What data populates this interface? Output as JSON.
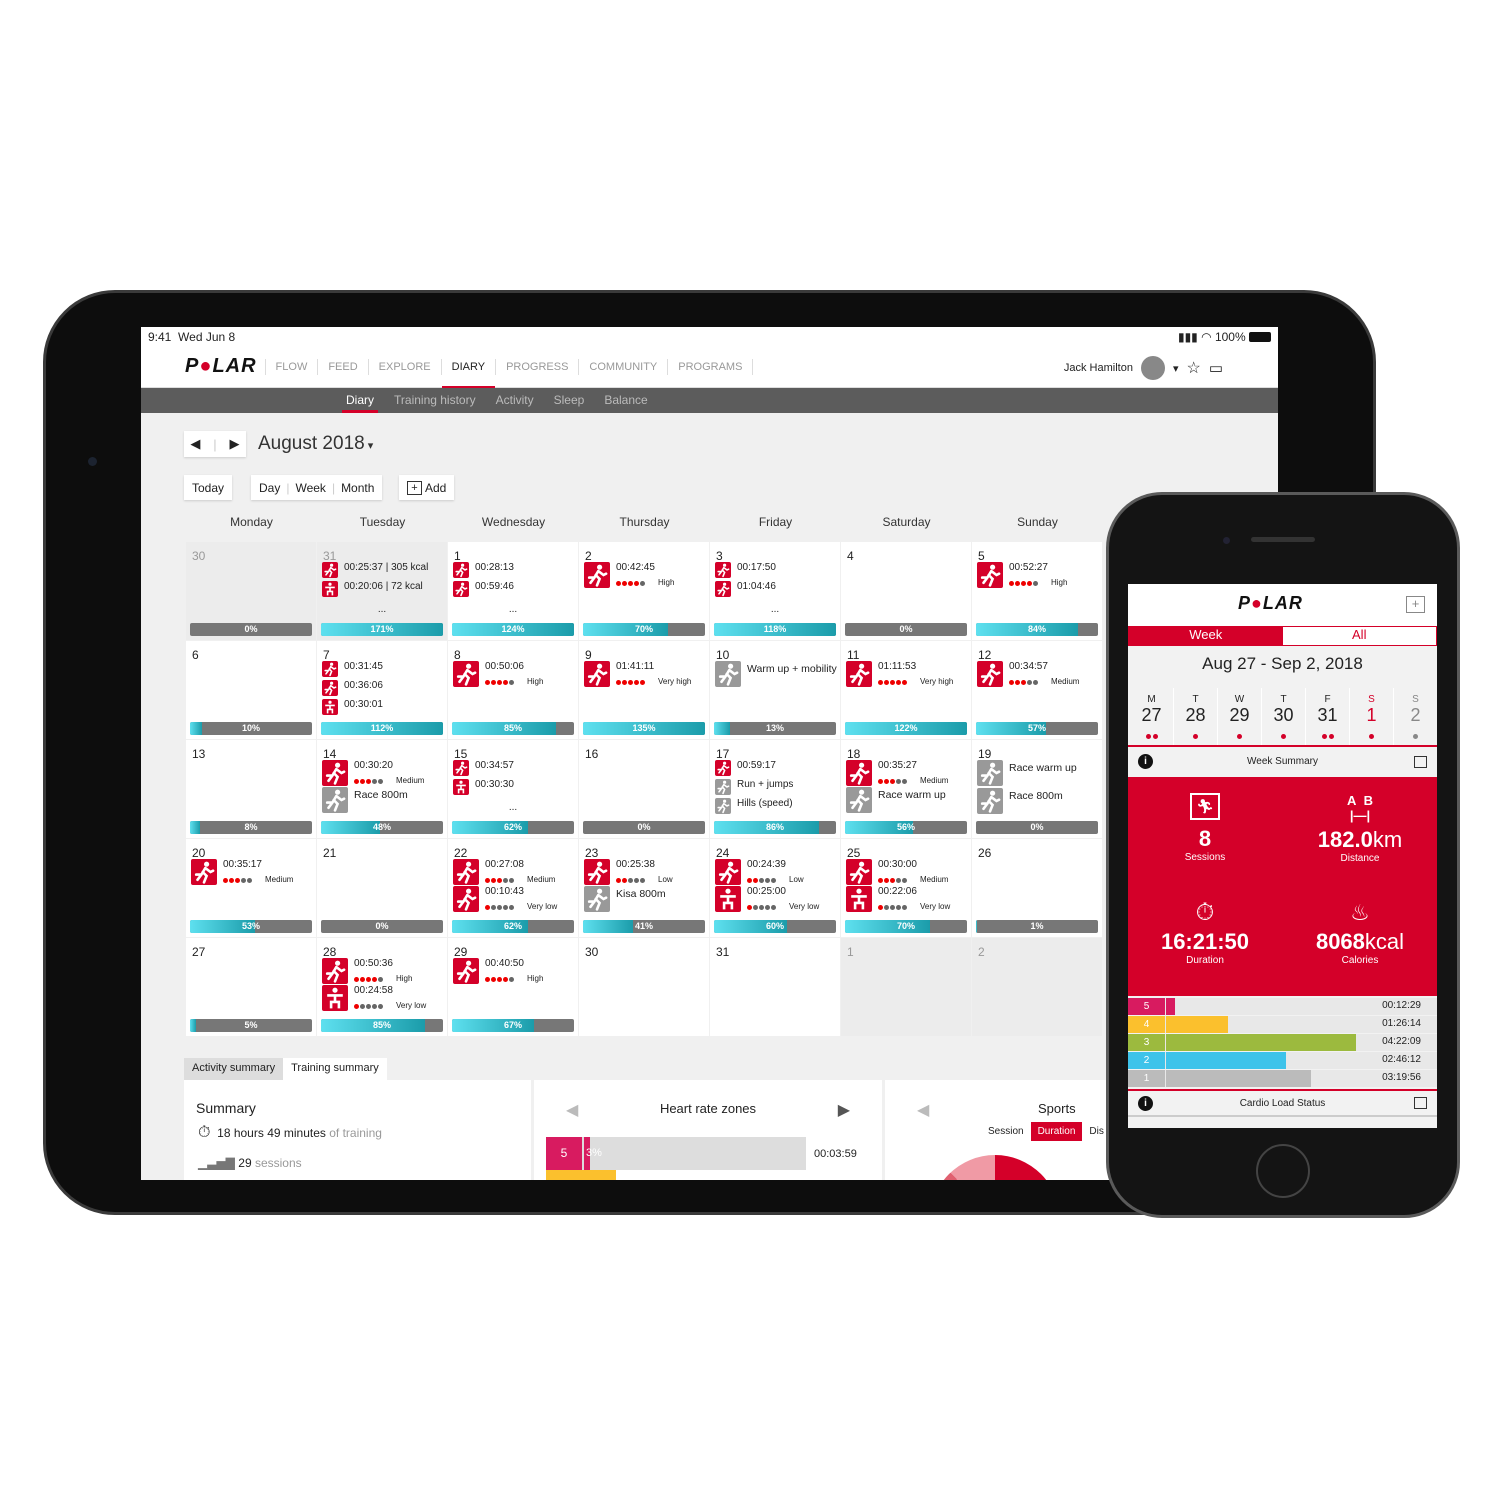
{
  "status": {
    "time": "9:41",
    "date": "Wed Jun 8",
    "battery": "100%"
  },
  "brand": {
    "logo": "POLAR",
    "accent": "#d40029",
    "teal": "#1b9caa"
  },
  "nav": {
    "items": [
      "FLOW",
      "FEED",
      "EXPLORE",
      "DIARY",
      "PROGRESS",
      "COMMUNITY",
      "PROGRAMS"
    ],
    "active": "DIARY",
    "user": "Jack Hamilton"
  },
  "subnav": {
    "items": [
      "Diary",
      "Training history",
      "Activity",
      "Sleep",
      "Balance"
    ],
    "active": "Diary"
  },
  "calendar": {
    "month": "August 2018",
    "today": "Today",
    "day": "Day",
    "week": "Week",
    "month_btn": "Month",
    "add": "Add",
    "weekdays": [
      "Monday",
      "Tuesday",
      "Wednesday",
      "Thursday",
      "Friday",
      "Saturday",
      "Sunday"
    ],
    "cells": [
      {
        "day": "30",
        "muted": true,
        "progress": 0,
        "sessions": []
      },
      {
        "day": "31",
        "muted": true,
        "progress": 171,
        "more": "...",
        "sessions": [
          {
            "sport": "run",
            "time": "00:25:37 | 305 kcal"
          },
          {
            "sport": "strength",
            "time": "00:20:06 | 72 kcal"
          }
        ]
      },
      {
        "day": "1",
        "progress": 124,
        "more": "...",
        "sessions": [
          {
            "sport": "run",
            "time": "00:28:13"
          },
          {
            "sport": "run",
            "time": "00:59:46"
          }
        ]
      },
      {
        "day": "2",
        "progress": 70,
        "sessions": [
          {
            "sport": "run",
            "time": "00:42:45",
            "dots": 4,
            "intensity": "High"
          }
        ]
      },
      {
        "day": "3",
        "progress": 118,
        "more": "...",
        "sessions": [
          {
            "sport": "run",
            "time": "00:17:50"
          },
          {
            "sport": "run",
            "time": "01:04:46"
          }
        ]
      },
      {
        "day": "4",
        "progress": 0,
        "sessions": []
      },
      {
        "day": "5",
        "progress": 84,
        "sessions": [
          {
            "sport": "run",
            "time": "00:52:27",
            "dots": 4,
            "intensity": "High"
          }
        ]
      },
      {
        "day": "6",
        "progress": 10,
        "sessions": []
      },
      {
        "day": "7",
        "progress": 112,
        "sessions": [
          {
            "sport": "run",
            "time": "00:31:45"
          },
          {
            "sport": "run",
            "time": "00:36:06"
          },
          {
            "sport": "strength",
            "time": "00:30:01"
          }
        ]
      },
      {
        "day": "8",
        "progress": 85,
        "sessions": [
          {
            "sport": "run",
            "time": "00:50:06",
            "dots": 4,
            "intensity": "High"
          }
        ]
      },
      {
        "day": "9",
        "progress": 135,
        "sessions": [
          {
            "sport": "run",
            "time": "01:41:11",
            "dots": 5,
            "intensity": "Very high"
          }
        ]
      },
      {
        "day": "10",
        "progress": 13,
        "sessions": [
          {
            "sport": "run",
            "planned": true,
            "time": "Warm up + mobility"
          }
        ]
      },
      {
        "day": "11",
        "progress": 122,
        "sessions": [
          {
            "sport": "run",
            "time": "01:11:53",
            "dots": 5,
            "intensity": "Very high"
          }
        ]
      },
      {
        "day": "12",
        "progress": 57,
        "sessions": [
          {
            "sport": "run",
            "time": "00:34:57",
            "dots": 3,
            "intensity": "Medium"
          }
        ]
      },
      {
        "day": "13",
        "progress": 8,
        "sessions": []
      },
      {
        "day": "14",
        "progress": 48,
        "sessions": [
          {
            "sport": "run",
            "time": "00:30:20",
            "dots": 3,
            "intensity": "Medium"
          },
          {
            "sport": "run",
            "planned": true,
            "time": "Race 800m"
          }
        ]
      },
      {
        "day": "15",
        "progress": 62,
        "more": "...",
        "sessions": [
          {
            "sport": "run",
            "time": "00:34:57"
          },
          {
            "sport": "strength",
            "time": "00:30:30"
          }
        ]
      },
      {
        "day": "16",
        "progress": 0,
        "sessions": []
      },
      {
        "day": "17",
        "progress": 86,
        "sessions": [
          {
            "sport": "run",
            "time": "00:59:17"
          },
          {
            "sport": "run",
            "planned": true,
            "time": "Run + jumps"
          },
          {
            "sport": "run",
            "planned": true,
            "time": "Hills (speed)"
          }
        ]
      },
      {
        "day": "18",
        "progress": 56,
        "sessions": [
          {
            "sport": "run",
            "time": "00:35:27",
            "dots": 3,
            "intensity": "Medium"
          },
          {
            "sport": "run",
            "planned": true,
            "time": "Race warm up"
          }
        ]
      },
      {
        "day": "19",
        "progress": 0,
        "sessions": [
          {
            "sport": "run",
            "planned": true,
            "time": "Race warm up"
          },
          {
            "sport": "run",
            "planned": true,
            "time": "Race 800m"
          }
        ]
      },
      {
        "day": "20",
        "progress": 53,
        "sessions": [
          {
            "sport": "run",
            "time": "00:35:17",
            "dots": 3,
            "intensity": "Medium"
          }
        ]
      },
      {
        "day": "21",
        "progress": 0,
        "sessions": []
      },
      {
        "day": "22",
        "progress": 62,
        "sessions": [
          {
            "sport": "run",
            "time": "00:27:08",
            "dots": 3,
            "intensity": "Medium"
          },
          {
            "sport": "run",
            "time": "00:10:43",
            "dots": 1,
            "intensity": "Very low"
          }
        ]
      },
      {
        "day": "23",
        "progress": 41,
        "sessions": [
          {
            "sport": "run",
            "time": "00:25:38",
            "dots": 2,
            "intensity": "Low"
          },
          {
            "sport": "run",
            "planned": true,
            "time": "Kisa 800m"
          }
        ]
      },
      {
        "day": "24",
        "progress": 60,
        "sessions": [
          {
            "sport": "run",
            "time": "00:24:39",
            "dots": 2,
            "intensity": "Low"
          },
          {
            "sport": "strength",
            "time": "00:25:00",
            "dots": 1,
            "intensity": "Very low"
          }
        ]
      },
      {
        "day": "25",
        "progress": 70,
        "sessions": [
          {
            "sport": "run",
            "time": "00:30:00",
            "dots": 3,
            "intensity": "Medium"
          },
          {
            "sport": "strength",
            "time": "00:22:06",
            "dots": 1,
            "intensity": "Very low"
          }
        ]
      },
      {
        "day": "26",
        "progress": 1,
        "sessions": []
      },
      {
        "day": "27",
        "progress": 5,
        "sessions": []
      },
      {
        "day": "28",
        "progress": 85,
        "sessions": [
          {
            "sport": "run",
            "time": "00:50:36",
            "dots": 4,
            "intensity": "High"
          },
          {
            "sport": "strength",
            "time": "00:24:58",
            "dots": 1,
            "intensity": "Very low"
          }
        ]
      },
      {
        "day": "29",
        "progress": 67,
        "sessions": [
          {
            "sport": "run",
            "time": "00:40:50",
            "dots": 4,
            "intensity": "High"
          }
        ]
      },
      {
        "day": "30",
        "sessions": []
      },
      {
        "day": "31",
        "sessions": []
      },
      {
        "day": "1",
        "muted": true,
        "sessions": []
      },
      {
        "day": "2",
        "muted": true,
        "sessions": []
      }
    ]
  },
  "summary": {
    "tabs": [
      "Activity summary",
      "Training summary"
    ],
    "active_tab": "Training summary",
    "title": "Summary",
    "hours": "18 hours 49 minutes",
    "hours_suffix": " of training",
    "sessions": "29",
    "sessions_suffix": " sessions",
    "hr_title": "Heart rate zones",
    "hr_zone": "5",
    "hr_pct": "3%",
    "hr_time": "00:03:59",
    "sports_title": "Sports",
    "sports_tabs": [
      "Session",
      "Duration",
      "Dis"
    ],
    "sports_active": "Duration"
  },
  "phone": {
    "logo": "POLAR",
    "tabs": [
      "Week",
      "All"
    ],
    "active_tab": "Week",
    "range": "Aug 27 - Sep 2, 2018",
    "days": [
      {
        "l": "M",
        "n": "27",
        "dots": 2
      },
      {
        "l": "T",
        "n": "28",
        "dots": 1
      },
      {
        "l": "W",
        "n": "29",
        "dots": 1
      },
      {
        "l": "T",
        "n": "30",
        "dots": 1
      },
      {
        "l": "F",
        "n": "31",
        "dots": 2
      },
      {
        "l": "S",
        "n": "1",
        "dots": 1,
        "today": true
      },
      {
        "l": "S",
        "n": "2",
        "dots": 1,
        "future": true
      }
    ],
    "week_summary": "Week Summary",
    "stats": {
      "sessions": "8",
      "sessions_label": "Sessions",
      "distance": "182.0",
      "distance_unit": "km",
      "distance_label": "Distance",
      "duration": "16:21:50",
      "duration_label": "Duration",
      "calories": "8068",
      "calories_unit": "kcal",
      "calories_label": "Calories"
    },
    "zones": [
      {
        "zone": "5",
        "time": "00:12:29",
        "color": "#d81b60"
      },
      {
        "zone": "4",
        "time": "01:26:14",
        "color": "#fbc02d"
      },
      {
        "zone": "3",
        "time": "04:22:09",
        "color": "#9cba3e"
      },
      {
        "zone": "2",
        "time": "02:46:12",
        "color": "#3ec3ea"
      },
      {
        "zone": "1",
        "time": "03:19:56",
        "color": "#bbbbbb"
      }
    ],
    "cardio": "Cardio Load Status"
  }
}
